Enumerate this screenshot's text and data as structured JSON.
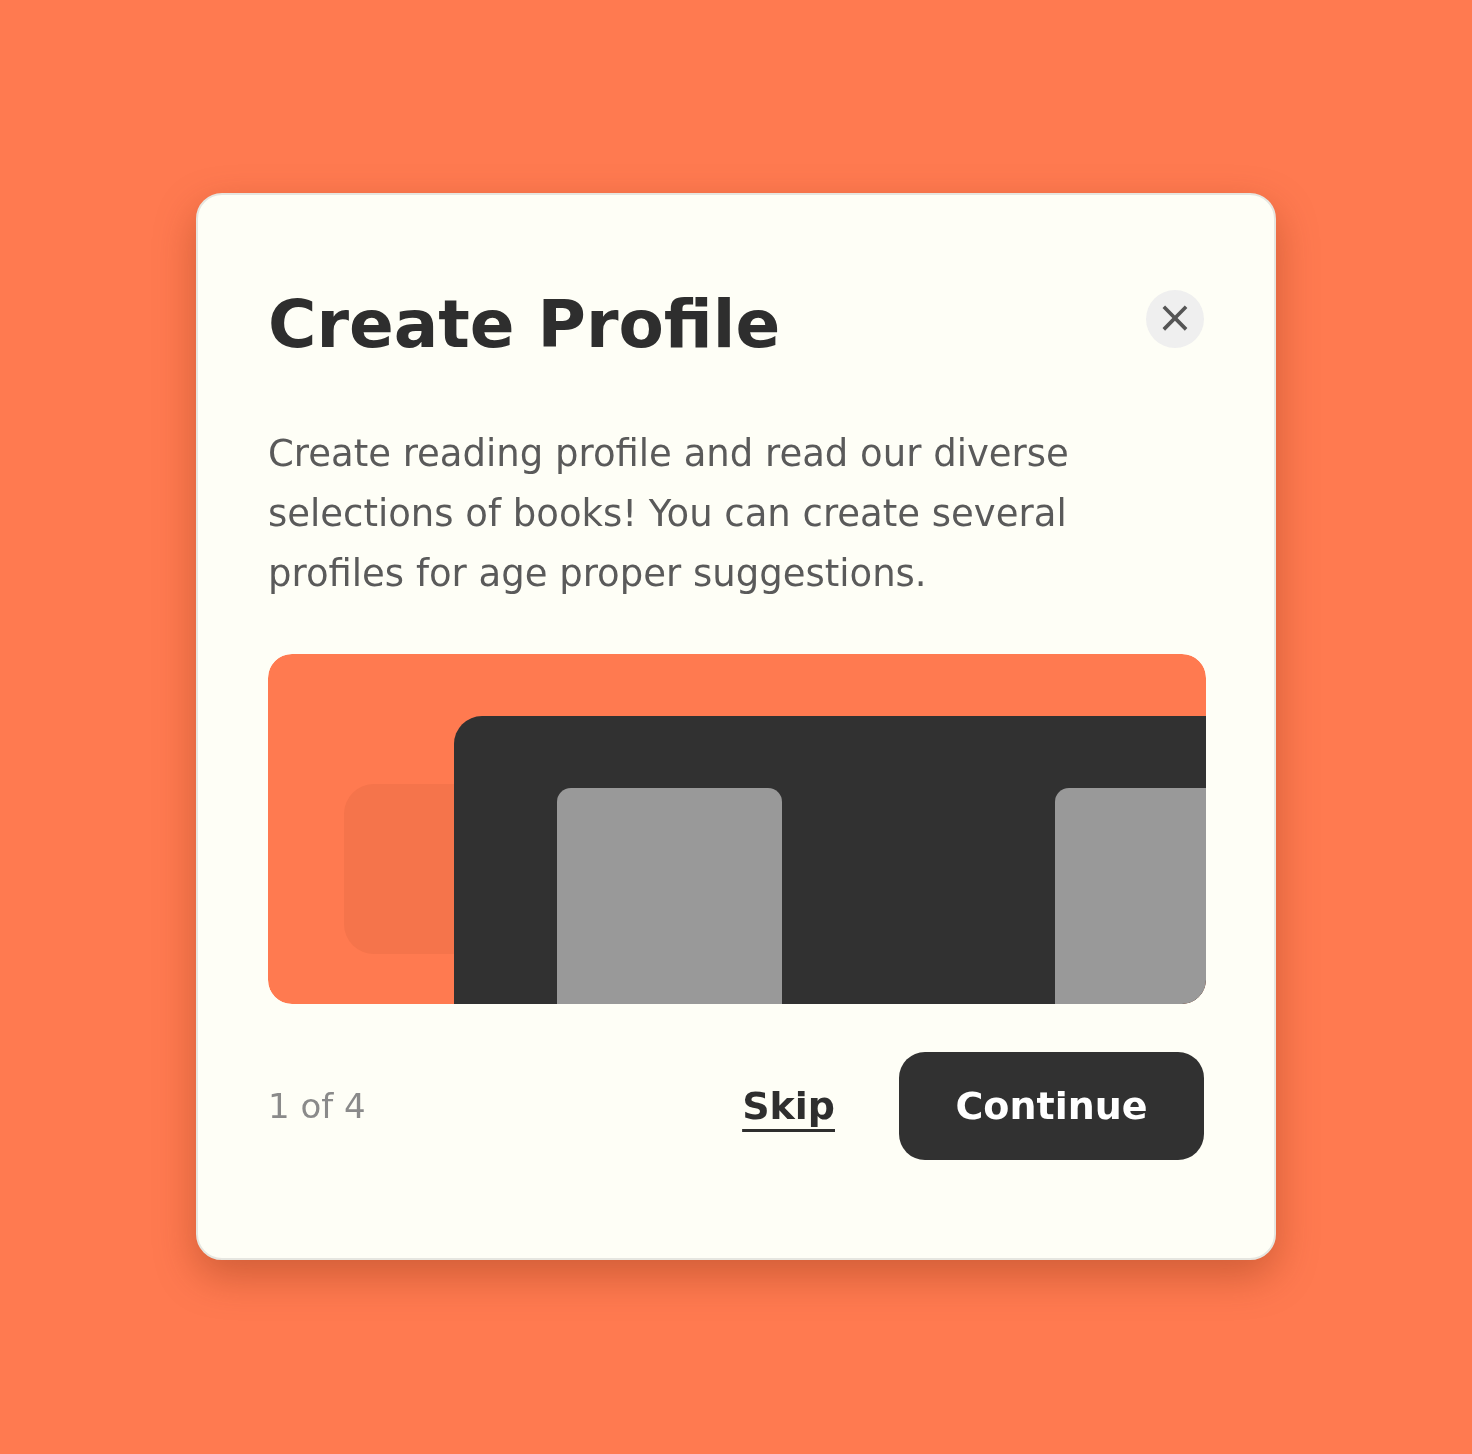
{
  "dialog": {
    "title": "Create Profile",
    "close_symbol": "×",
    "description": "Create reading profile and read our diverse selections of books! You can create several profiles for age proper suggestions.",
    "step": "1 of 4",
    "skip": "Skip",
    "continue": "Continue"
  }
}
